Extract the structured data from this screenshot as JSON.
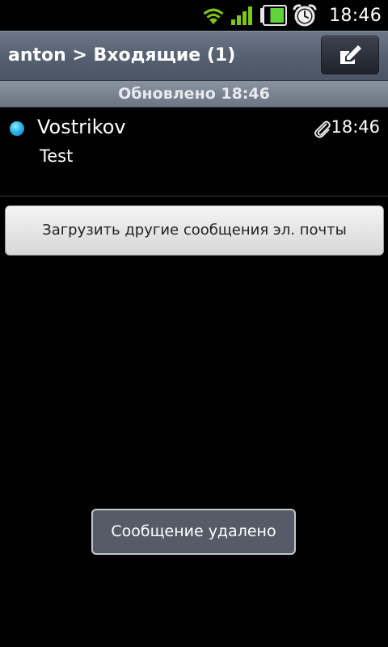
{
  "status_bar": {
    "time": "18:46",
    "icons": [
      "wifi-icon",
      "signal-icon",
      "battery-icon",
      "alarm-icon"
    ],
    "battery_level": 0.75
  },
  "header": {
    "title": "anton > Входящие (1)",
    "compose_icon": "compose-icon"
  },
  "sub_header": {
    "text": "Обновлено 18:46"
  },
  "messages": [
    {
      "sender": "Vostrikov",
      "subject": "Test",
      "time": "18:46",
      "unread": true,
      "has_attachment": true
    }
  ],
  "load_more": {
    "label": "Загрузить другие сообщения эл. почты"
  },
  "toast": {
    "text": "Сообщение удалено"
  },
  "colors": {
    "unread_dot": "#29b6ec",
    "wifi": "#7ec61a",
    "battery": "#5fd33a"
  }
}
